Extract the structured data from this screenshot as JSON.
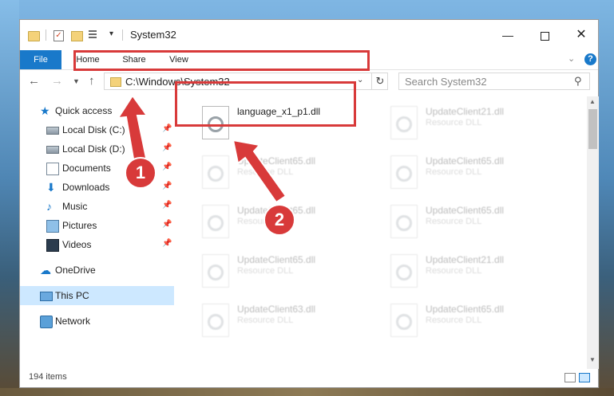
{
  "window": {
    "title": "System32"
  },
  "ribbon": {
    "tabs": [
      "File",
      "Home",
      "Share",
      "View"
    ],
    "help": "?"
  },
  "address": {
    "path": "C:\\Windows\\System32"
  },
  "search": {
    "placeholder": "Search System32"
  },
  "sidebar": {
    "items": [
      {
        "label": "Quick access",
        "icon": "star-icon"
      },
      {
        "label": "Local Disk (C:)",
        "icon": "disk-icon"
      },
      {
        "label": "Local Disk (D:)",
        "icon": "disk-icon"
      },
      {
        "label": "Documents",
        "icon": "documents-icon"
      },
      {
        "label": "Downloads",
        "icon": "download-icon"
      },
      {
        "label": "Music",
        "icon": "music-icon"
      },
      {
        "label": "Pictures",
        "icon": "pictures-icon"
      },
      {
        "label": "Videos",
        "icon": "videos-icon"
      },
      {
        "label": "OneDrive",
        "icon": "cloud-icon"
      },
      {
        "label": "This PC",
        "icon": "pc-icon"
      },
      {
        "label": "Network",
        "icon": "network-icon"
      }
    ]
  },
  "files": [
    {
      "name": "language_x1_p1.dll",
      "type": ""
    },
    {
      "name": "UpdateClient21.dll",
      "type": "Resource DLL"
    },
    {
      "name": "UpdateClient65.dll",
      "type": "Resource DLL"
    },
    {
      "name": "UpdateClient65.dll",
      "type": "Resource DLL"
    },
    {
      "name": "UpdateClient65.dll",
      "type": "Resource DLL"
    },
    {
      "name": "UpdateClient65.dll",
      "type": "Resource DLL"
    },
    {
      "name": "UpdateClient65.dll",
      "type": "Resource DLL"
    },
    {
      "name": "UpdateClient21.dll",
      "type": "Resource DLL"
    },
    {
      "name": "UpdateClient63.dll",
      "type": "Resource DLL"
    },
    {
      "name": "UpdateClient65.dll",
      "type": "Resource DLL"
    }
  ],
  "status": {
    "items": "194 items"
  },
  "annotations": {
    "step1": "1",
    "step2": "2",
    "color": "#d83a3a"
  }
}
